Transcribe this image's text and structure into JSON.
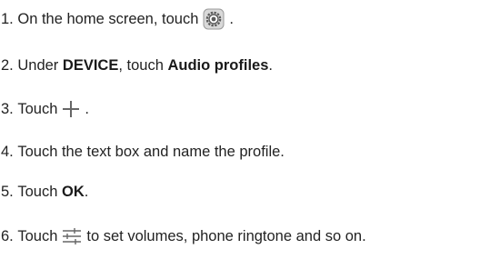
{
  "steps": [
    {
      "number": "1.",
      "text_before": "On the home screen, touch",
      "icon": "settings-gear-icon",
      "text_after": "."
    },
    {
      "number": "2.",
      "text_before": "Under",
      "bold1": "DEVICE",
      "text_mid": ", touch",
      "bold2": "Audio profiles",
      "text_after": "."
    },
    {
      "number": "3.",
      "text_before": "Touch",
      "icon": "plus-icon",
      "text_after": "."
    },
    {
      "number": "4.",
      "text": "Touch the text box and name the profile."
    },
    {
      "number": "5.",
      "text_before": "Touch",
      "bold": "OK",
      "text_after": "."
    },
    {
      "number": "6.",
      "text_before": "Touch",
      "icon": "equalizer-sliders-icon",
      "text_after": "to set volumes, phone ringtone and so on."
    }
  ],
  "colors": {
    "text": "#222222",
    "icon_stroke": "#666666",
    "background": "#ffffff"
  }
}
